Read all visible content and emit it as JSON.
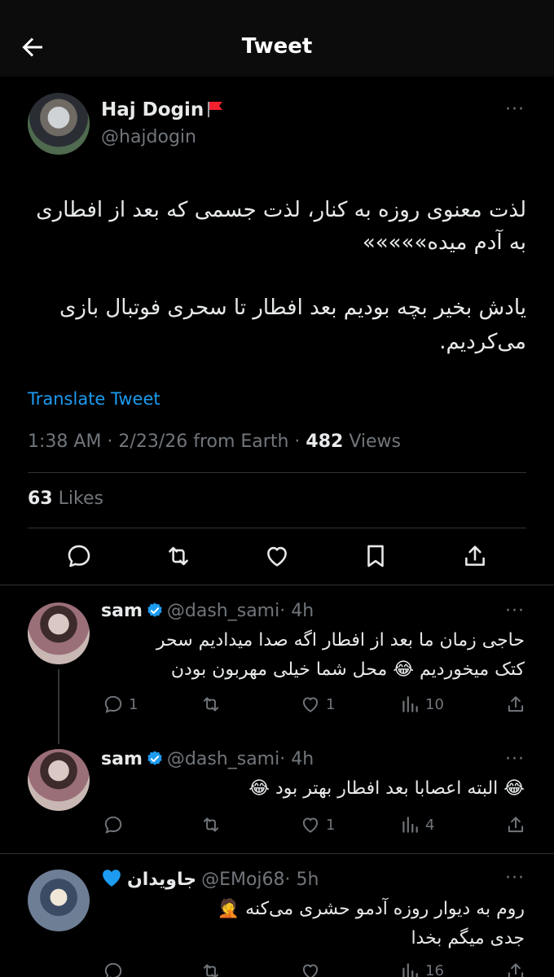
{
  "header": {
    "title": "Tweet"
  },
  "tweet": {
    "author_name": "Haj Dogin",
    "author_handle": "@hajdogin",
    "text_line1": "لذت معنوی روزه به کنار، لذت جسمی که بعد از افطاری",
    "text_line2": "به آدم میده»»»»»",
    "text_line3": "یادش بخیر بچه بودیم بعد افطار تا سحری فوتبال بازی",
    "text_line4": "می‌کردیم.",
    "translate": "Translate Tweet",
    "meta_prefix": "1:38 AM · 2/23/26 from Earth · ",
    "views_count": "482",
    "views_label": " Views",
    "likes_count": "63",
    "likes_label": " Likes",
    "more": "···"
  },
  "replies": [
    {
      "name": "sam",
      "handle": "@dash_sami",
      "time": "· 4h",
      "line1": "حاجی زمان ما بعد از افطار اگه صدا میدادیم سحر",
      "line2": "کتک میخوردیم 😂 محل شما خیلی مهربون بودن",
      "reply_count": "1",
      "like_count": "1",
      "views_count": "10"
    },
    {
      "name": "sam",
      "handle": "@dash_sami",
      "time": "· 4h",
      "line1": "😂 البته اعصابا بعد افطار بهتر بود 😂",
      "like_count": "1",
      "views_count": "4"
    },
    {
      "name": "جاویدان",
      "handle": "@EMoj68",
      "time": "· 5h",
      "line1": "روم به دیوار روزه آدمو حشری می‌کنه 🤦",
      "line2": "جدی میگم بخدا",
      "views_count": "16"
    }
  ],
  "colors": {
    "accent": "#1d9bf0",
    "muted": "#71767b",
    "text": "#e7e9ea",
    "flag": "#f4212e"
  },
  "icons": [
    "back-arrow-icon",
    "more-icon",
    "reply-icon",
    "retweet-icon",
    "like-icon",
    "bookmark-icon",
    "share-icon",
    "views-icon",
    "verified-icon"
  ]
}
